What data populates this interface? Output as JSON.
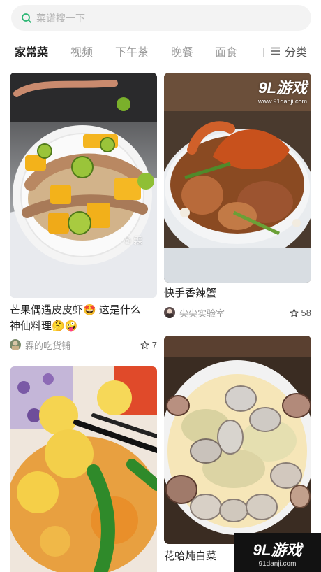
{
  "search": {
    "placeholder": "菜谱搜一下"
  },
  "tabs": [
    {
      "label": "家常菜",
      "active": true
    },
    {
      "label": "视频",
      "active": false
    },
    {
      "label": "下午茶",
      "active": false
    },
    {
      "label": "晚餐",
      "active": false
    },
    {
      "label": "面食",
      "active": false
    }
  ],
  "category_button": {
    "label": "分类",
    "icon": "menu-icon"
  },
  "cards": [
    {
      "title_line1": "芒果偶遇皮皮虾🤩 这是什么",
      "title_line2": "神仙料理🤔🤪",
      "author": "霖的吃货铺",
      "likes": "7",
      "photo_credit": "© 霖"
    },
    {
      "title_line1": "快手香辣蟹",
      "author": "尖尖实验室",
      "likes": "58",
      "watermark_big": "9L游戏",
      "watermark_small": "www.91danji.com"
    },
    {
      "title_line1": ""
    },
    {
      "title_line1": "花蛤炖白菜"
    }
  ],
  "brand_badge": {
    "name": "9L游戏",
    "url": "91danji.com"
  },
  "colors": {
    "accent": "#2bb673",
    "text": "#222222",
    "muted": "#999999"
  }
}
